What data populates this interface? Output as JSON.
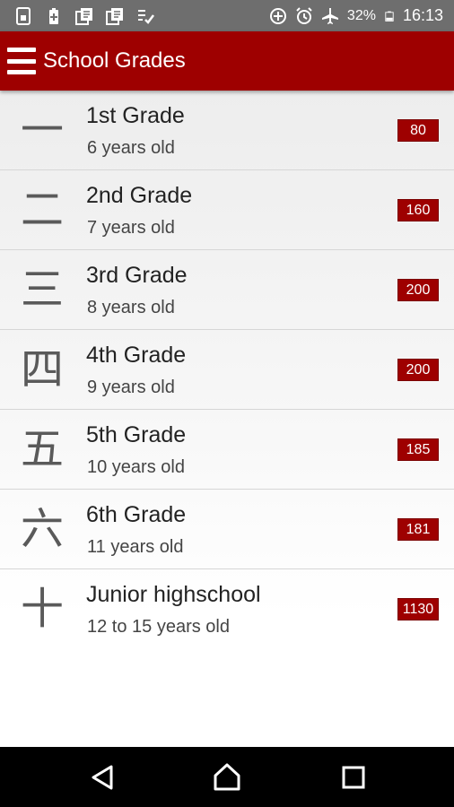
{
  "status_bar": {
    "battery_percent": "32%",
    "time": "16:13",
    "left_icons": [
      "sim-card-icon",
      "battery-saver-icon",
      "notes-icon",
      "notes-icon",
      "checklist-icon"
    ],
    "right_icons": [
      "data-saver-icon",
      "alarm-icon",
      "airplane-mode-icon",
      "battery-icon"
    ]
  },
  "app_bar": {
    "title": "School Grades",
    "menu_icon": "hamburger-menu-icon",
    "color": "#9e0000"
  },
  "grades": [
    {
      "kanji": "一",
      "title": "1st Grade",
      "subtitle": "6 years old",
      "count": "80"
    },
    {
      "kanji": "二",
      "title": "2nd Grade",
      "subtitle": "7 years old",
      "count": "160"
    },
    {
      "kanji": "三",
      "title": "3rd Grade",
      "subtitle": "8 years old",
      "count": "200"
    },
    {
      "kanji": "四",
      "title": "4th Grade",
      "subtitle": "9 years old",
      "count": "200"
    },
    {
      "kanji": "五",
      "title": "5th Grade",
      "subtitle": "10 years old",
      "count": "185"
    },
    {
      "kanji": "六",
      "title": "6th Grade",
      "subtitle": "11 years old",
      "count": "181"
    },
    {
      "kanji": "十",
      "title": "Junior highschool",
      "subtitle": "12 to 15 years old",
      "count": "1130"
    }
  ],
  "nav_bar": {
    "buttons": [
      "back-icon",
      "home-icon",
      "recents-icon"
    ]
  }
}
